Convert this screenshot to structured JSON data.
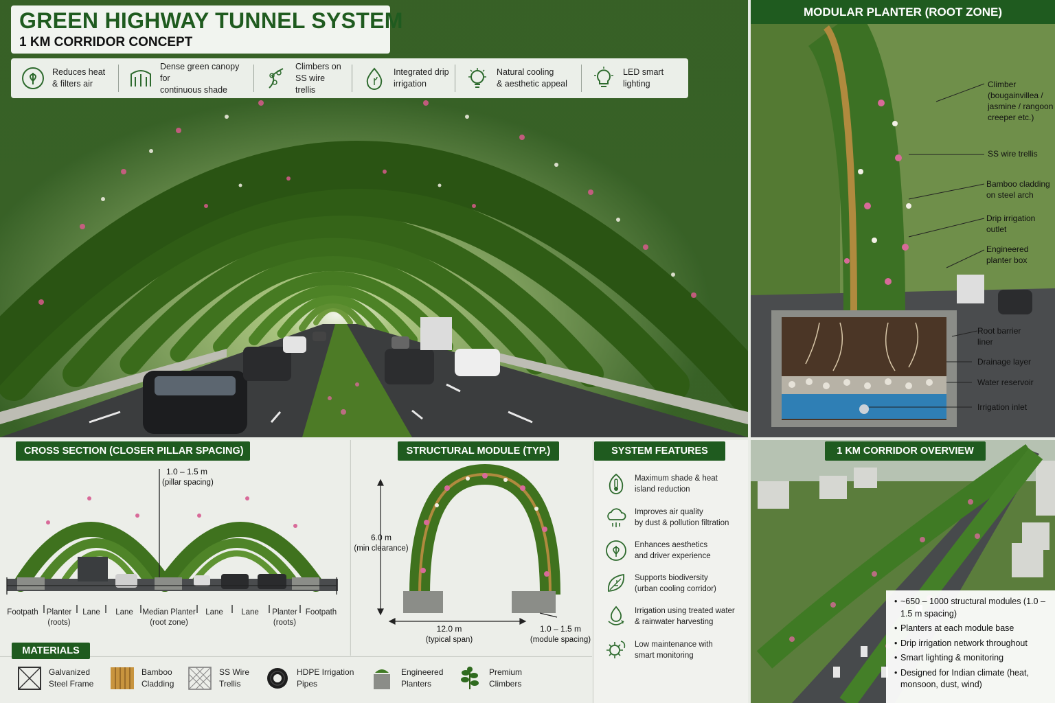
{
  "header": {
    "title": "GREEN HIGHWAY TUNNEL SYSTEM",
    "subtitle": "1 KM CORRIDOR CONCEPT"
  },
  "benefits": [
    {
      "icon": "leaf-icon",
      "line1": "Reduces heat",
      "line2": "& filters air"
    },
    {
      "icon": "canopy-icon",
      "line1": "Dense green canopy for",
      "line2": "continuous shade"
    },
    {
      "icon": "climber-icon",
      "line1": "Climbers on",
      "line2": "SS wire trellis"
    },
    {
      "icon": "water-drop-icon",
      "line1": "Integrated drip",
      "line2": "irrigation"
    },
    {
      "icon": "cooling-bulb-icon",
      "line1": "Natural cooling",
      "line2": "& aesthetic appeal"
    },
    {
      "icon": "led-bulb-icon",
      "line1": "LED smart",
      "line2": "lighting"
    }
  ],
  "planter": {
    "title": "MODULAR PLANTER (ROOT ZONE)",
    "callouts": [
      "Climber (bougainvillea / jasmine / rangoon creeper etc.)",
      "SS wire trellis",
      "Bamboo cladding on steel arch",
      "Drip irrigation outlet",
      "Engineered planter box",
      "Root barrier liner",
      "Drainage layer",
      "Water reservoir",
      "Irrigation inlet"
    ]
  },
  "cross_section": {
    "title": "CROSS SECTION (CLOSER PILLAR SPACING)",
    "spacing_value": "1.0 – 1.5 m",
    "spacing_note": "(pillar spacing)",
    "labels": [
      {
        "l1": "Footpath",
        "l2": ""
      },
      {
        "l1": "Planter",
        "l2": "(roots)"
      },
      {
        "l1": "Lane",
        "l2": ""
      },
      {
        "l1": "Lane",
        "l2": ""
      },
      {
        "l1": "Median Planter",
        "l2": "(root zone)"
      },
      {
        "l1": "Lane",
        "l2": ""
      },
      {
        "l1": "Lane",
        "l2": ""
      },
      {
        "l1": "Planter",
        "l2": "(roots)"
      },
      {
        "l1": "Footpath",
        "l2": ""
      }
    ]
  },
  "structural_module": {
    "title": "STRUCTURAL MODULE (TYP.)",
    "height_value": "6.0 m",
    "height_note": "(min clearance)",
    "span_value": "12.0 m",
    "span_note": "(typical span)",
    "spacing_value": "1.0 – 1.5 m",
    "spacing_note": "(module spacing)"
  },
  "features": {
    "title": "SYSTEM FEATURES",
    "items": [
      {
        "icon": "thermometer-leaf-icon",
        "l1": "Maximum shade & heat",
        "l2": "island reduction"
      },
      {
        "icon": "cloud-filter-icon",
        "l1": "Improves air quality",
        "l2": "by dust & pollution filtration"
      },
      {
        "icon": "leaf-circle-icon",
        "l1": "Enhances aesthetics",
        "l2": "and driver experience"
      },
      {
        "icon": "biodiversity-leaf-icon",
        "l1": "Supports biodiversity",
        "l2": "(urban cooling corridor)"
      },
      {
        "icon": "water-recycle-icon",
        "l1": "Irrigation using treated water",
        "l2": "& rainwater harvesting"
      },
      {
        "icon": "maintenance-gear-icon",
        "l1": "Low maintenance with",
        "l2": "smart monitoring"
      }
    ]
  },
  "materials": {
    "title": "MATERIALS",
    "items": [
      {
        "icon": "steel-frame-icon",
        "l1": "Galvanized",
        "l2": "Steel Frame"
      },
      {
        "icon": "bamboo-icon",
        "l1": "Bamboo",
        "l2": "Cladding"
      },
      {
        "icon": "wire-mesh-icon",
        "l1": "SS Wire",
        "l2": "Trellis"
      },
      {
        "icon": "pipe-coil-icon",
        "l1": "HDPE Irrigation",
        "l2": "Pipes"
      },
      {
        "icon": "planter-box-icon",
        "l1": "Engineered",
        "l2": "Planters"
      },
      {
        "icon": "climber-plant-icon",
        "l1": "Premium",
        "l2": "Climbers"
      }
    ]
  },
  "overview": {
    "title": "1 KM CORRIDOR OVERVIEW",
    "bullets": [
      "~650 – 1000 structural modules (1.0 – 1.5 m spacing)",
      "Planters at each module base",
      "Drip irrigation network throughout",
      "Smart lighting & monitoring",
      "Designed for Indian climate (heat, monsoon, dust, wind)"
    ]
  }
}
